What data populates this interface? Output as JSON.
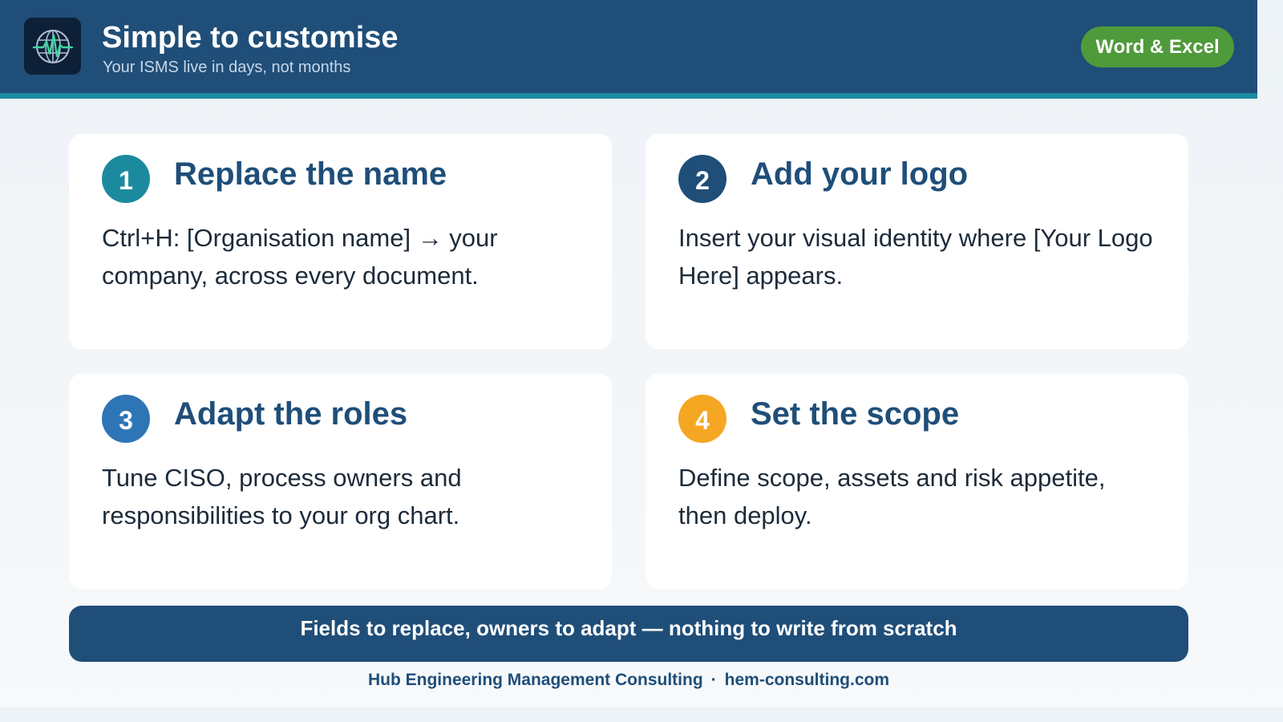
{
  "header": {
    "title": "Simple to customise",
    "subtitle": "Your ISMS live in days, not months",
    "badge": "Word & Excel",
    "logo_icon": "globe-heartbeat-icon"
  },
  "colors": {
    "header_bg": "#1f4e79",
    "accent_line": "#1c8a9e",
    "badge_bg": "#4f9a3a",
    "step1": "#1c8a9e",
    "step2": "#1f4e79",
    "step3": "#2e75b6",
    "step4": "#f5a623"
  },
  "steps": [
    {
      "number": "1",
      "title": "Replace the name",
      "body": "Ctrl+H: [Organisation name] → your company, across every document."
    },
    {
      "number": "2",
      "title": "Add your logo",
      "body": "Insert your visual identity where [Your Logo Here] appears."
    },
    {
      "number": "3",
      "title": "Adapt the roles",
      "body": "Tune CISO, process owners and responsibilities to your org chart."
    },
    {
      "number": "4",
      "title": "Set the scope",
      "body": "Define scope, assets and risk appetite, then deploy."
    }
  ],
  "banner": "Fields to replace, owners to adapt — nothing to write from scratch",
  "footer": {
    "company": "Hub Engineering Management Consulting",
    "separator": "·",
    "website": "hem-consulting.com"
  }
}
